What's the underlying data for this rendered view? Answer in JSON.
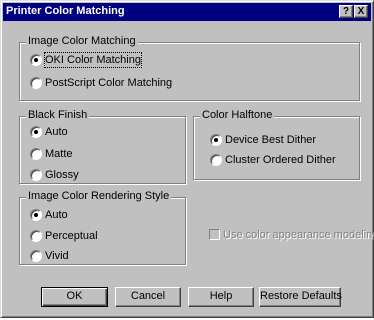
{
  "window": {
    "title": "Printer Color Matching",
    "help_label": "?",
    "close_label": "X"
  },
  "image_color_matching": {
    "legend": "Image Color Matching",
    "options": [
      {
        "label": "OKI Color Matching",
        "selected": true
      },
      {
        "label": "PostScript Color Matching",
        "selected": false
      }
    ]
  },
  "black_finish": {
    "legend": "Black Finish",
    "options": [
      {
        "label": "Auto",
        "selected": true
      },
      {
        "label": "Matte",
        "selected": false
      },
      {
        "label": "Glossy",
        "selected": false
      }
    ]
  },
  "color_halftone": {
    "legend": "Color Halftone",
    "options": [
      {
        "label": "Device Best Dither",
        "selected": true
      },
      {
        "label": "Cluster Ordered Dither",
        "selected": false
      }
    ]
  },
  "rendering_style": {
    "legend": "Image Color Rendering Style",
    "options": [
      {
        "label": "Auto",
        "selected": true
      },
      {
        "label": "Perceptual",
        "selected": false
      },
      {
        "label": "Vivid",
        "selected": false
      }
    ]
  },
  "appearance_modeling": {
    "label": "Use color appearance modeling",
    "checked": false,
    "enabled": false
  },
  "buttons": {
    "ok": "OK",
    "cancel": "Cancel",
    "help": "Help",
    "restore": "Restore Defaults"
  }
}
